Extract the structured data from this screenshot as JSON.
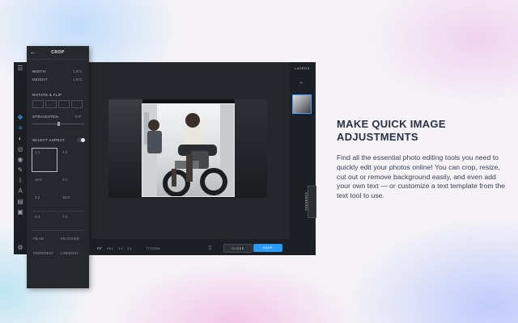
{
  "crop_panel": {
    "title": "CROP",
    "back_icon": "arrow-left-icon",
    "width_label": "WIDTH",
    "width_value": "1,972",
    "height_label": "HEIGHT",
    "height_value": "1,973",
    "rotate_flip_label": "ROTATE & FLIP",
    "straighten_label": "STRAIGHTEN",
    "straighten_value": "0.0°",
    "select_aspect_label": "SELECT ASPECT",
    "aspects": [
      "1:1",
      "4:3",
      "16:9",
      "3:1",
      "3:2",
      "16:9",
      "5:4",
      "7:4",
      "FB AD",
      "FB COVER",
      "PINTEREST",
      "LINKEDIN"
    ]
  },
  "layers": {
    "title": "LAYERS"
  },
  "feedback_label": "FEEDBACK",
  "bottom_bar": {
    "zoom_items": [
      "FIT",
      "FILL",
      "1:1",
      "1:4",
      "77 ZOOM"
    ],
    "close_label": "CLOSE",
    "save_label": "SAVE"
  },
  "promo": {
    "heading": "MAKE QUICK IMAGE ADJUSTMENTS",
    "body": "Find all the essential photo editing tools you need to quickly edit your photos online! You can crop, resize, cut out or remove background easily, and even add your own text — or customize a text template from the text tool to use."
  },
  "colors": {
    "accent": "#2b9bf4",
    "panel": "#25282d",
    "heading": "#2a3142"
  }
}
